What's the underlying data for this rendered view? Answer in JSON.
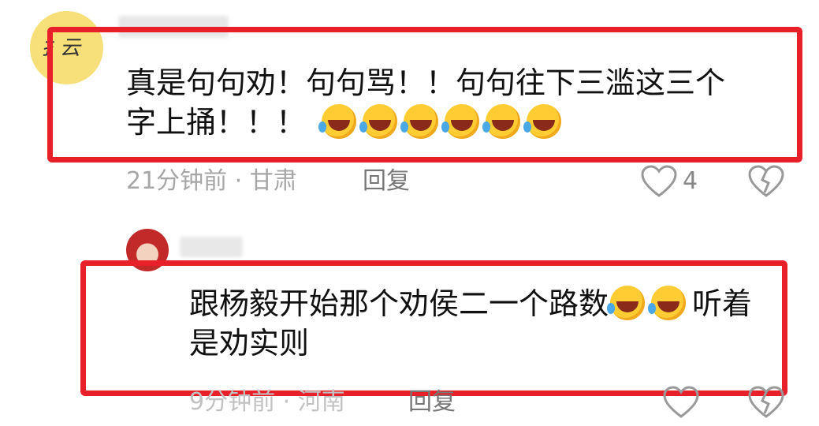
{
  "comment1": {
    "text_line1": "真是句句劝！句句骂！！句句往下三滥这三个",
    "text_line2": "字上捅！！！",
    "emoji_count": 6,
    "time": "21分钟前 · 甘肃",
    "reply_label": "回复",
    "likes": "4"
  },
  "comment2": {
    "text_line1": "跟杨毅开始那个劝侯二一个路数",
    "text_line1_tail": "听着",
    "text_line2": "是劝实则",
    "emoji_count": 2,
    "time": "9分钟前 · 河南",
    "reply_label": "回复"
  },
  "icons": {
    "like": "heart-outline-icon",
    "dislike": "broken-heart-icon",
    "emoji": "rolling-laughing-face"
  },
  "colors": {
    "highlight_box": "#e8202a",
    "meta_text": "#a6a6a6",
    "avatar1_bg": "#f7e07a"
  }
}
